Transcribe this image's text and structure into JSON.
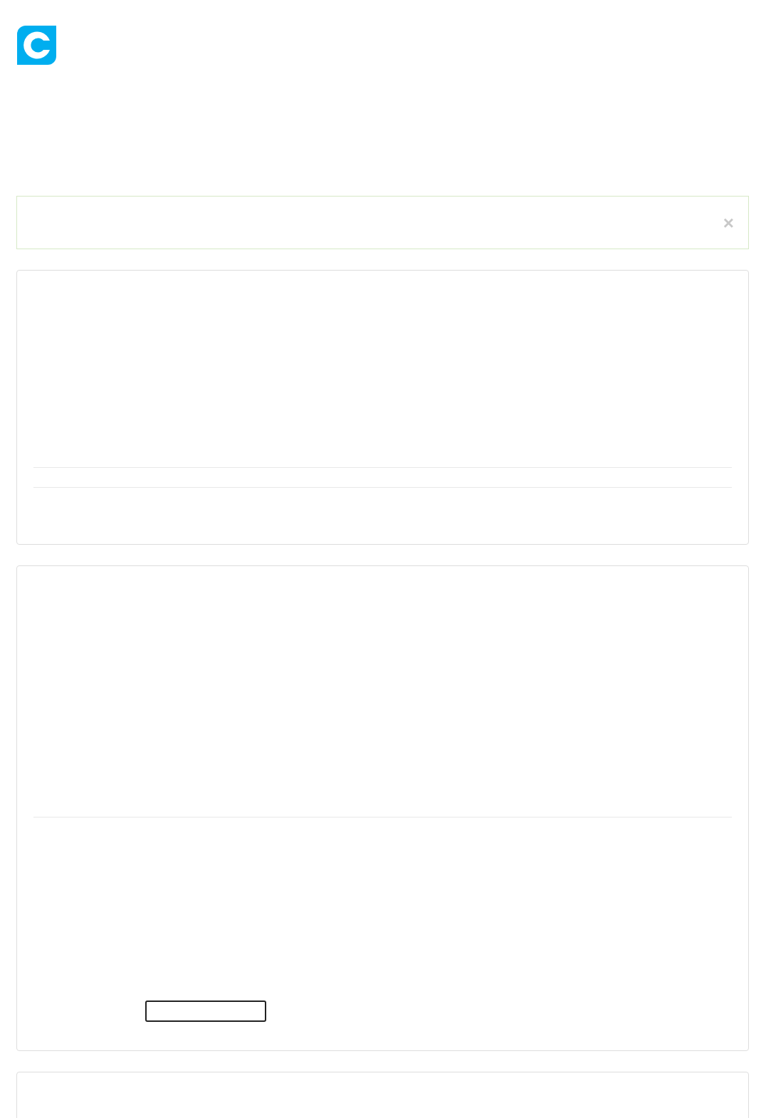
{
  "alert": {
    "close": "×"
  }
}
